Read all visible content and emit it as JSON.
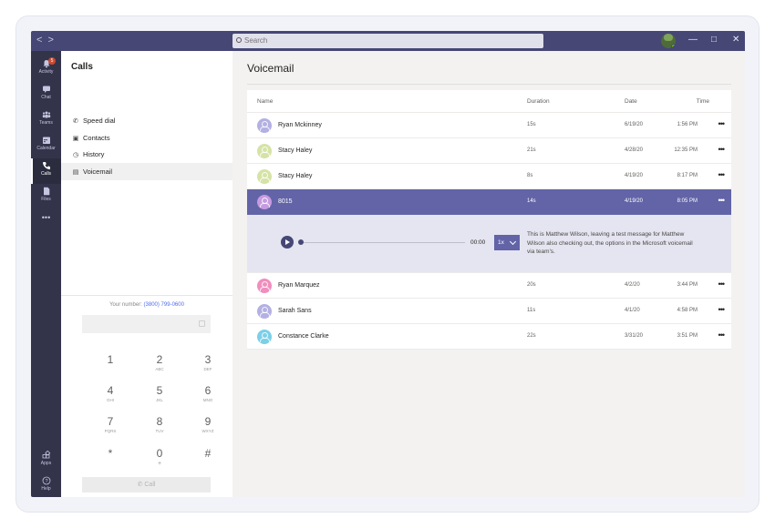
{
  "titlebar": {
    "back": "<",
    "forward": ">",
    "search_placeholder": "Search",
    "minimize": "—",
    "maximize": "□",
    "close": "✕"
  },
  "rail": {
    "items": [
      {
        "label": "Activity",
        "icon": "bell-icon",
        "badge": "5"
      },
      {
        "label": "Chat",
        "icon": "chat-icon"
      },
      {
        "label": "Teams",
        "icon": "teams-icon"
      },
      {
        "label": "Calendar",
        "icon": "calendar-icon"
      },
      {
        "label": "Calls",
        "icon": "phone-icon",
        "active": true
      },
      {
        "label": "Files",
        "icon": "file-icon"
      },
      {
        "label": "•••",
        "icon": "more-icon"
      }
    ],
    "apps_label": "Apps",
    "help_label": "Help"
  },
  "calls_panel": {
    "title": "Calls",
    "nav": [
      {
        "label": "Speed dial",
        "icon": "phone-icon"
      },
      {
        "label": "Contacts",
        "icon": "contacts-icon"
      },
      {
        "label": "History",
        "icon": "clock-icon"
      },
      {
        "label": "Voicemail",
        "icon": "voicemail-icon",
        "active": true
      }
    ],
    "your_number_label": "Your number:",
    "your_number": "(3800) 799-0600",
    "keypad": [
      {
        "digit": "1",
        "letters": ""
      },
      {
        "digit": "2",
        "letters": "ABC"
      },
      {
        "digit": "3",
        "letters": "DEF"
      },
      {
        "digit": "4",
        "letters": "GHI"
      },
      {
        "digit": "5",
        "letters": "JKL"
      },
      {
        "digit": "6",
        "letters": "MNO"
      },
      {
        "digit": "7",
        "letters": "PQRS"
      },
      {
        "digit": "8",
        "letters": "TUV"
      },
      {
        "digit": "9",
        "letters": "WXYZ"
      },
      {
        "digit": "*",
        "letters": ""
      },
      {
        "digit": "0",
        "letters": "+"
      },
      {
        "digit": "#",
        "letters": ""
      }
    ],
    "call_button": "Call"
  },
  "voicemail": {
    "title": "Voicemail",
    "columns": {
      "name": "Name",
      "duration": "Duration",
      "date": "Date",
      "time": "Time"
    },
    "rows": [
      {
        "name": "Ryan Mckinney",
        "duration": "15s",
        "date": "6/19/20",
        "time": "1:56 PM",
        "avatar_color": "#b3b0e3"
      },
      {
        "name": "Stacy Haley",
        "duration": "21s",
        "date": "4/28/20",
        "time": "12:35 PM",
        "avatar_color": "#d5e3a6"
      },
      {
        "name": "Stacy Haley",
        "duration": "8s",
        "date": "4/19/20",
        "time": "8:17 PM",
        "avatar_color": "#d5e3a6"
      },
      {
        "name": "8015",
        "duration": "14s",
        "date": "4/19/20",
        "time": "8:05 PM",
        "avatar_color": "#c69be0",
        "selected": true
      },
      {
        "name": "Ryan Marquez",
        "duration": "20s",
        "date": "4/2/20",
        "time": "3:44 PM",
        "avatar_color": "#f08ebd"
      },
      {
        "name": "Sarah Sans",
        "duration": "11s",
        "date": "4/1/20",
        "time": "4:58 PM",
        "avatar_color": "#b3b0e3"
      },
      {
        "name": "Constance Clarke",
        "duration": "22s",
        "date": "3/31/20",
        "time": "3:51 PM",
        "avatar_color": "#7ccfe8"
      }
    ],
    "more_label": "•••",
    "player": {
      "time": "00:00",
      "speed": "1x",
      "progress": 0,
      "transcript": "This is Matthew Wilson, leaving a test message for Matthew Wilson also checking out, the options in the Microsoft voicemail via team's."
    }
  },
  "colors": {
    "titlebar": "#464775",
    "rail": "#33344a",
    "accent": "#6264a7",
    "expanded_bg": "#e5e5f1"
  }
}
